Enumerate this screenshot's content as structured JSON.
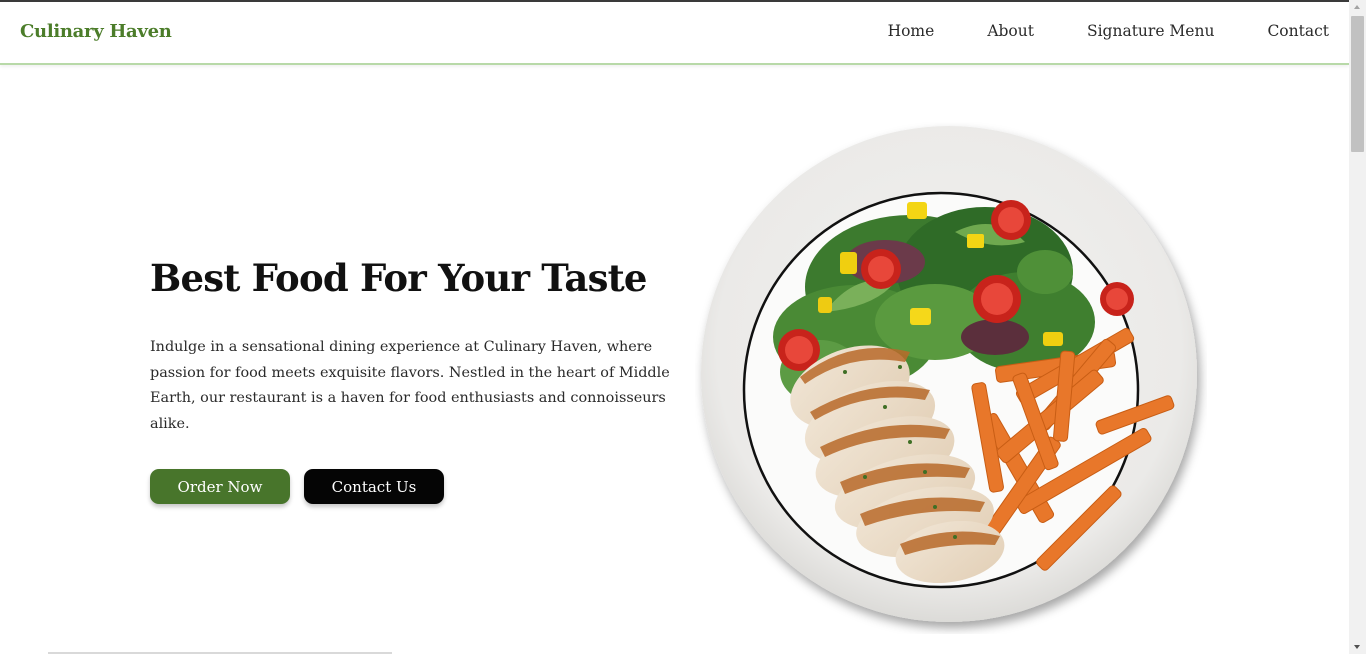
{
  "brand": {
    "name": "Culinary Haven",
    "color": "#4c7d2a"
  },
  "nav": {
    "items": [
      {
        "label": "Home"
      },
      {
        "label": "About"
      },
      {
        "label": "Signature Menu"
      },
      {
        "label": "Contact"
      }
    ]
  },
  "hero": {
    "title": "Best Food For Your Taste",
    "description": "Indulge in a sensational dining experience at Culinary Haven, where passion for food meets exquisite flavors. Nestled in the heart of Middle Earth, our restaurant is a haven for food enthusiasts and connoisseurs alike.",
    "buttons": {
      "order_label": "Order Now",
      "contact_label": "Contact Us"
    },
    "image": {
      "icon": "food-plate-image"
    }
  },
  "colors": {
    "primary_green": "#48752b",
    "navbar_border": "#b8d9a8",
    "dark_button": "#050505"
  }
}
